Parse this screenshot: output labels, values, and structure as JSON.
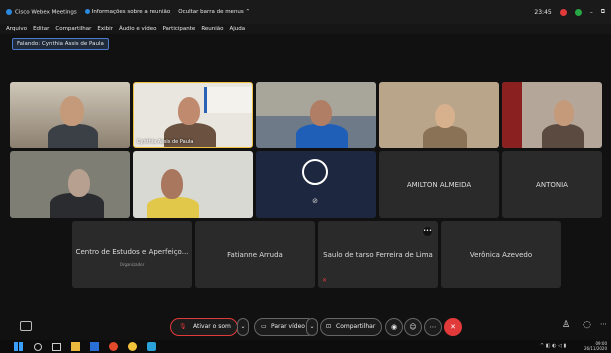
{
  "app": {
    "title": "Cisco Webex Meetings",
    "info": "Informações sobre a reunião",
    "hide_menu": "Ocultar barra de menus",
    "time": "23:45"
  },
  "menu": [
    "Arquivo",
    "Editar",
    "Compartilhar",
    "Exibir",
    "Áudio e vídeo",
    "Participante",
    "Reunião",
    "Ajuda"
  ],
  "speaker": "Falando: Cynthia Assis de Paula",
  "tiles": {
    "cynthia": "Cynthia Assis de Paula",
    "amilton": "AMILTON ALMEIDA",
    "antonia": "ANTONIA",
    "centro": "Centro de Estudos e Aperfeiço...",
    "centro_sub": "Organizador",
    "fatianne": "Fatianne Arruda",
    "saulo": "Saulo de tarso Ferreira de Lima",
    "veronica": "Verônica Azevedo"
  },
  "toolbar": {
    "unmute": "Ativar o som",
    "stop_video": "Parar vídeo",
    "share": "Compartilhar"
  },
  "taskbar": {
    "time": "09:00",
    "date": "26/11/2020"
  }
}
